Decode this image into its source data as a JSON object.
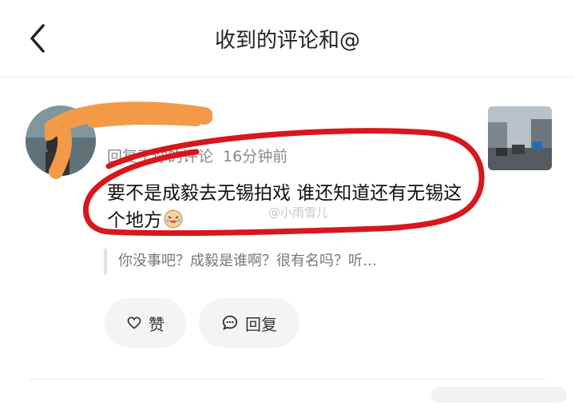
{
  "header": {
    "title": "收到的评论和@"
  },
  "comment": {
    "reply_label": "回复了你的评论",
    "time": "16分钟前",
    "text": "要不是成毅去无锡拍戏 谁还知道还有无锡这个地方",
    "watermark": "@小雨雪儿",
    "quoted_text": "你没事吧？成毅是谁啊？很有名吗？听…"
  },
  "actions": {
    "like_label": "赞",
    "reply_label": "回复"
  },
  "colors": {
    "annotation_red": "#d8161c",
    "scribble_orange": "#f29a47",
    "pill_bg": "#f4f4f4"
  }
}
